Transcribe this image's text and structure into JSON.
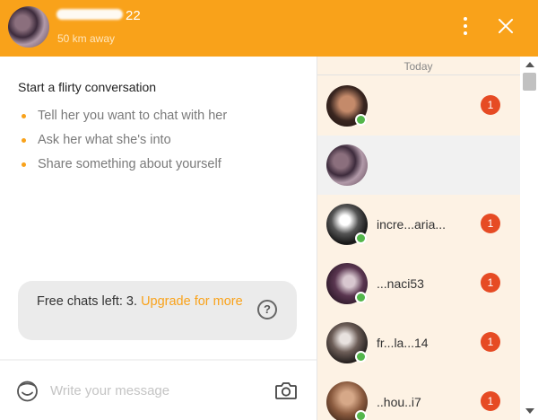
{
  "header": {
    "user_age": "22",
    "distance": "50 km away",
    "menu_icon": "more-vertical-icon",
    "close_icon": "close-icon",
    "accent_color": "#f9a21a"
  },
  "left_panel": {
    "title": "Start a flirty conversation",
    "tips": [
      "Tell her you want to chat with her",
      "Ask her what she's into",
      "Share something about yourself"
    ],
    "free_chats_text": "Free chats left: 3.",
    "upgrade_link": "Upgrade for more",
    "help_icon_label": "?"
  },
  "composer": {
    "placeholder": "Write your message",
    "value": "",
    "emoji_icon": "emoji-icon",
    "camera_icon": "camera-icon"
  },
  "conversations": {
    "section_label": "Today",
    "items": [
      {
        "name": "",
        "unread": "1",
        "online": true
      },
      {
        "name": "",
        "unread": "",
        "online": false,
        "active": true
      },
      {
        "name": "incre...aria...",
        "unread": "1",
        "online": true
      },
      {
        "name": "...naci53",
        "unread": "1",
        "online": true
      },
      {
        "name": "fr...la...14",
        "unread": "1",
        "online": true
      },
      {
        "name": "..hou..i7",
        "unread": "1",
        "online": true
      }
    ],
    "unread_color": "#e64b24",
    "online_color": "#54b64b"
  }
}
